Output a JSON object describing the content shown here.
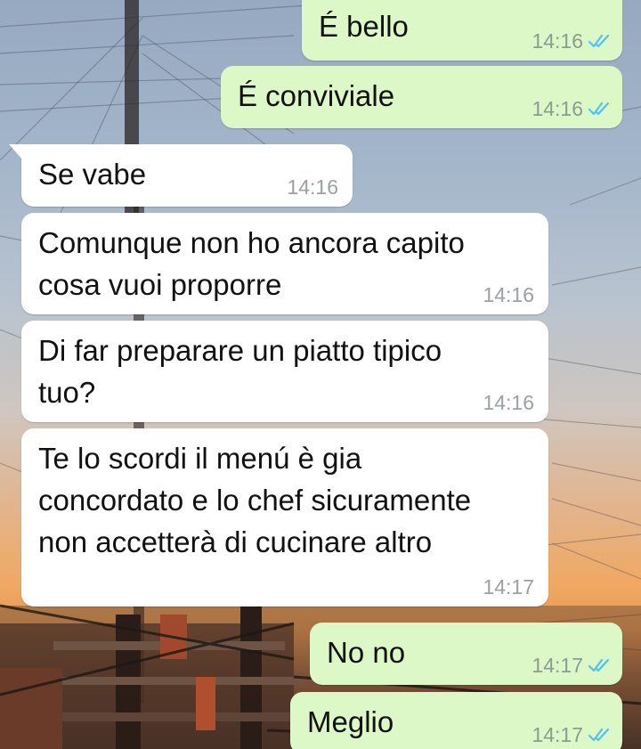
{
  "theme": {
    "incoming_bubble": "#ffffff",
    "outgoing_bubble": "#dcf8c6",
    "read_ticks": "#4fc3f7",
    "time_color": "#9aa0a3"
  },
  "messages": [
    {
      "direction": "out",
      "text": "É bello",
      "time": "14:16",
      "status": "read"
    },
    {
      "direction": "out",
      "text": "É conviviale",
      "time": "14:16",
      "status": "read"
    },
    {
      "direction": "in",
      "text": "Se vabe",
      "time": "14:16"
    },
    {
      "direction": "in",
      "text": "Comunque non ho ancora capito\ncosa vuoi proporre",
      "time": "14:16"
    },
    {
      "direction": "in",
      "text": "Di far preparare un piatto tipico\ntuo?",
      "time": "14:16"
    },
    {
      "direction": "in",
      "text": "Te lo scordi il menú è gia\nconcordato e lo chef sicuramente\nnon accetterà di cucinare altro",
      "time": "14:17"
    },
    {
      "direction": "out",
      "text": "No no",
      "time": "14:17",
      "status": "read"
    },
    {
      "direction": "out",
      "text": "Meglio",
      "time": "14:17",
      "status": "read"
    }
  ]
}
